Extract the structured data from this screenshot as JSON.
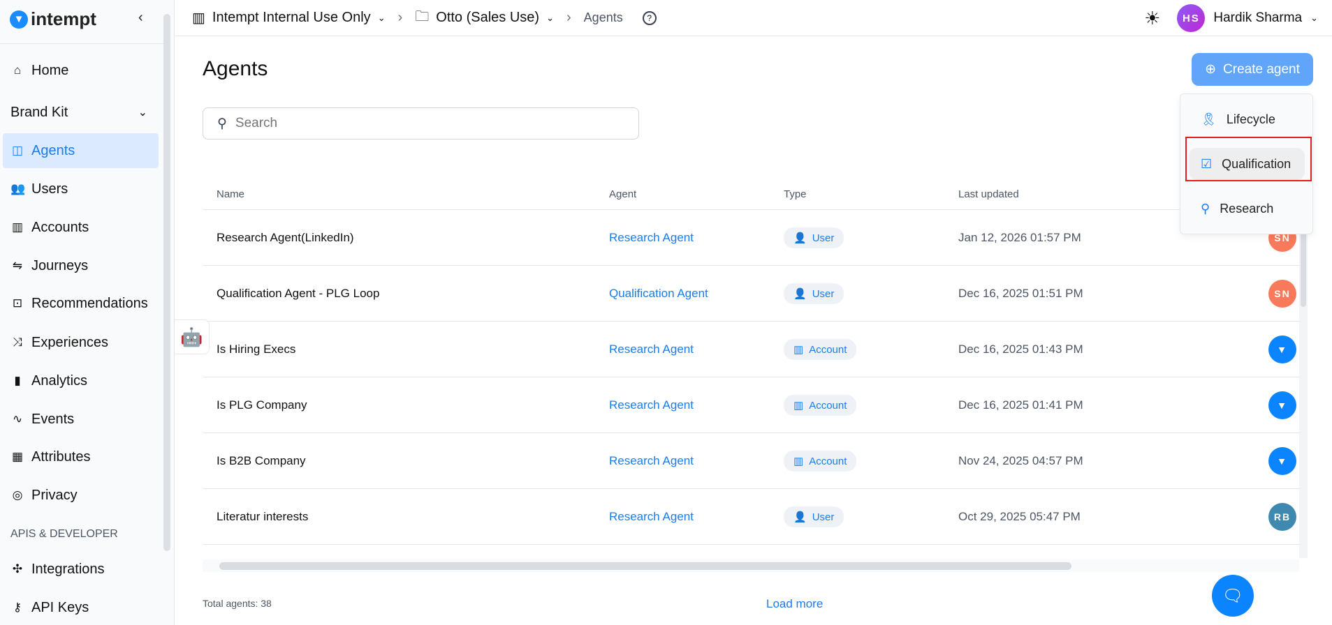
{
  "brand": {
    "name": "intempt"
  },
  "sidebar": {
    "items": [
      {
        "label": "Home",
        "icon": "home-icon",
        "glyph": "⌂"
      },
      {
        "label": "Brand Kit",
        "icon": "",
        "glyph": ""
      },
      {
        "label": "Agents",
        "icon": "bot-icon",
        "glyph": "◫",
        "active": true
      },
      {
        "label": "Users",
        "icon": "users-icon",
        "glyph": "👥"
      },
      {
        "label": "Accounts",
        "icon": "building-icon",
        "glyph": "▥"
      },
      {
        "label": "Journeys",
        "icon": "route-icon",
        "glyph": "⇋"
      },
      {
        "label": "Recommendations",
        "icon": "bag-icon",
        "glyph": "⊡"
      },
      {
        "label": "Experiences",
        "icon": "shuffle-icon",
        "glyph": "⤨"
      },
      {
        "label": "Analytics",
        "icon": "bar-chart-icon",
        "glyph": "▮"
      },
      {
        "label": "Events",
        "icon": "activity-icon",
        "glyph": "∿"
      },
      {
        "label": "Attributes",
        "icon": "table-icon",
        "glyph": "▦"
      },
      {
        "label": "Privacy",
        "icon": "mask-icon",
        "glyph": "◎"
      }
    ],
    "section_label": "APIS & DEVELOPER",
    "dev_items": [
      {
        "label": "Integrations",
        "icon": "puzzle-icon",
        "glyph": "✣"
      },
      {
        "label": "API Keys",
        "icon": "key-icon",
        "glyph": "⚷"
      }
    ]
  },
  "header": {
    "breadcrumbs": [
      "Intempt Internal Use Only",
      "Otto (Sales Use)",
      "Agents"
    ],
    "user_initials": "HS",
    "user_name": "Hardik Sharma"
  },
  "page": {
    "title": "Agents",
    "create_label": "Create agent",
    "search_placeholder": "Search",
    "menu": [
      "Lifecycle",
      "Qualification",
      "Research"
    ],
    "highlighted_menu_item": "Qualification"
  },
  "table": {
    "columns": [
      "Name",
      "Agent",
      "Type",
      "Last updated"
    ],
    "rows": [
      {
        "name": "Research Agent(LinkedIn)",
        "agent": "Research Agent",
        "type": "User",
        "updated": "Jan 12, 2026 01:57 PM",
        "owner": "SN",
        "owner_color": "#f87a5b"
      },
      {
        "name": "Qualification Agent - PLG Loop",
        "agent": "Qualification Agent",
        "type": "User",
        "updated": "Dec 16, 2025 01:51 PM",
        "owner": "SN",
        "owner_color": "#f87a5b"
      },
      {
        "name": "Is Hiring Execs",
        "agent": "Research Agent",
        "type": "Account",
        "updated": "Dec 16, 2025 01:43 PM",
        "owner": "",
        "owner_color": "#0a84ff"
      },
      {
        "name": "Is PLG Company",
        "agent": "Research Agent",
        "type": "Account",
        "updated": "Dec 16, 2025 01:41 PM",
        "owner": "",
        "owner_color": "#0a84ff"
      },
      {
        "name": "Is B2B Company",
        "agent": "Research Agent",
        "type": "Account",
        "updated": "Nov 24, 2025 04:57 PM",
        "owner": "",
        "owner_color": "#0a84ff"
      },
      {
        "name": "Literatur interests",
        "agent": "Research Agent",
        "type": "User",
        "updated": "Oct 29, 2025 05:47 PM",
        "owner": "RB",
        "owner_color": "#3f88b0"
      }
    ]
  },
  "footer": {
    "total": "Total agents: 38",
    "load_more": "Load more"
  },
  "colors": {
    "accent": "#1a7cf0",
    "button": "#60a5fa",
    "active_bg": "#dbeafe"
  }
}
